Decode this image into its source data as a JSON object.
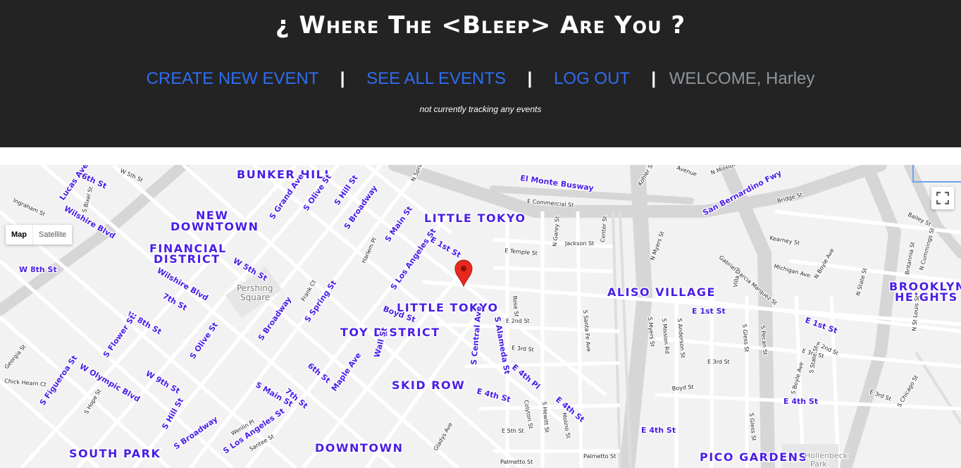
{
  "header": {
    "title": "¿ Where The <Bleep> Are You ?",
    "nav": {
      "create_event": "CREATE NEW EVENT",
      "see_all_events": "SEE ALL EVENTS",
      "log_out": "LOG OUT",
      "separator": "|",
      "welcome": "WELCOME, Harley"
    },
    "status": "not currently tracking any events"
  },
  "map": {
    "map_type": {
      "map_label": "Map",
      "satellite_label": "Satellite",
      "selected": "Map"
    },
    "marker_icon": "map-pin-icon",
    "fullscreen_icon": "fullscreen-icon",
    "marker_color": "#e8281e",
    "label_color": "#4a1ee6",
    "neighborhoods": [
      "BUNKER HILL",
      "NEW",
      "DOWNTOWN",
      "LITTLE TOKYO",
      "FINANCIAL",
      "DISTRICT",
      "ALISO VILLAGE",
      "BROOKLYN",
      "HEIGHTS",
      "LITTLE TOKYO",
      "TOY DISTRICT",
      "SKID ROW",
      "SOUTH PARK",
      "DOWNTOWN",
      "PICO GARDENS"
    ],
    "highlighted_streets": [
      "Lucas Ave",
      "6th St",
      "Wilshire Blvd",
      "S Grand Ave",
      "S Olive St",
      "S Hill St",
      "S Broadway",
      "El Monte Busway",
      "San Bernardino Fwy",
      "W 8th St",
      "W 5th St",
      "Wilshire Blvd",
      "7th St",
      "S Main St",
      "S Los Angeles St",
      "E 1st St",
      "W 8th St",
      "S Flower St",
      "S Olive St",
      "S Spring St",
      "S Broadway",
      "S Figueroa St",
      "W Olympic Blvd",
      "W 9th St",
      "6th St",
      "Maple Ave",
      "S Main St",
      "7th St",
      "S Hill St",
      "S Broadway",
      "S Los Angeles St",
      "E 1st St",
      "E 1st St",
      "E 4th Pl",
      "E 4th St",
      "E 4th St",
      "E 4th St",
      "E 4th St",
      "S Central Ave",
      "S Alameda St",
      "Wall St",
      "Boyd St"
    ],
    "minor_streets": [
      "W 5th St",
      "Ingraham St",
      "S Bixel St",
      "E Commercial St",
      "Harlem Pl",
      "N Garey St",
      "Jackson St",
      "Center St",
      "E Temple St",
      "Kearney St",
      "Michigan Ave",
      "N Boyle Ave",
      "Bridge St",
      "Bailey St",
      "Britannia St",
      "N Cummings St",
      "N State St",
      "N St Louis St",
      "Gabriel Garcia Marquez St",
      "Villa Dr",
      "N Myers St",
      "Pershing",
      "Square",
      "Frank Ct",
      "Rose St",
      "E 2nd St",
      "E 3rd St",
      "S Santa Fe Ave",
      "S Myers St",
      "S Mission Rd",
      "S Anderson St",
      "E 3rd St",
      "Boyd St",
      "S Gless St",
      "S Pecan St",
      "E 2nd St",
      "E 3rd St",
      "S Boyle Ave",
      "S State St",
      "E 3rd St",
      "S Chicago St",
      "Georgia St",
      "Chick Hearn Ct",
      "S Hope St",
      "Wenlin Pl",
      "Santee St",
      "Gladys Ave",
      "E 5th St",
      "Colyton St",
      "S Hewitt St",
      "Molino St",
      "Palmetto St",
      "Palmetto St",
      "S Gless St",
      "Hollenbeck",
      "Park",
      "N Spring",
      "Kohler St",
      "Avenue",
      "N Mission"
    ]
  }
}
